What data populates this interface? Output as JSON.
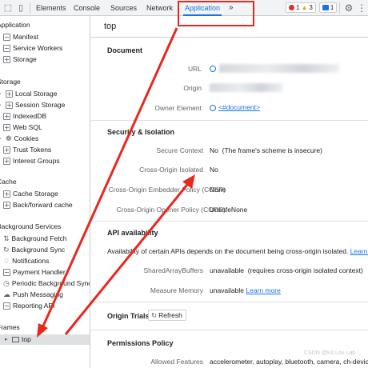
{
  "toolbar": {
    "tabs": [
      "Elements",
      "Console",
      "Sources",
      "Network",
      "Application"
    ],
    "more": "»",
    "errors": "1",
    "warnings": "3",
    "messages": "1"
  },
  "sidebar": {
    "application": {
      "title": "Application",
      "items": [
        "Manifest",
        "Service Workers",
        "Storage"
      ]
    },
    "storage": {
      "title": "Storage",
      "items": [
        "Local Storage",
        "Session Storage",
        "IndexedDB",
        "Web SQL",
        "Cookies",
        "Trust Tokens",
        "Interest Groups"
      ]
    },
    "cache": {
      "title": "Cache",
      "items": [
        "Cache Storage",
        "Back/forward cache"
      ]
    },
    "background": {
      "title": "Background Services",
      "items": [
        "Background Fetch",
        "Background Sync",
        "Notifications",
        "Payment Handler",
        "Periodic Background Sync",
        "Push Messaging",
        "Reporting API"
      ]
    },
    "frames": {
      "title": "Frames",
      "items": [
        "top"
      ]
    }
  },
  "main": {
    "title": "top",
    "document": {
      "title": "Document",
      "url_label": "URL",
      "origin_label": "Origin",
      "owner_label": "Owner Element",
      "owner_value": "<#document>"
    },
    "security": {
      "title": "Security & Isolation",
      "secure_label": "Secure Context",
      "secure_value": "No",
      "secure_note": "(The frame's scheme is insecure)",
      "coi_label": "Cross-Origin Isolated",
      "coi_value": "No",
      "coep_label": "Cross-Origin Embedder Policy (COEP)",
      "coep_value": "None",
      "coop_label": "Cross-Origin Opener Policy (COOP)",
      "coop_value": "UnsafeNone"
    },
    "api": {
      "title": "API availability",
      "desc": "Availability of certain APIs depends on the document being cross-origin isolated.",
      "learn_more": "Learn more",
      "sab_label": "SharedArrayBuffers",
      "sab_value": "unavailable",
      "sab_note": "(requires cross-origin isolated context)",
      "mm_label": "Measure Memory",
      "mm_value": "unavailable",
      "mm_link": "Learn more"
    },
    "origin_trials": {
      "title": "Origin Trials",
      "refresh": "Refresh"
    },
    "permissions": {
      "title": "Permissions Policy",
      "allowed_label": "Allowed Features",
      "allowed_value": "accelerometer, autoplay, bluetooth, camera, ch-device-"
    }
  },
  "watermark": "CSDN @Kit Lou Lab",
  "annotation_color": "#e8281e"
}
